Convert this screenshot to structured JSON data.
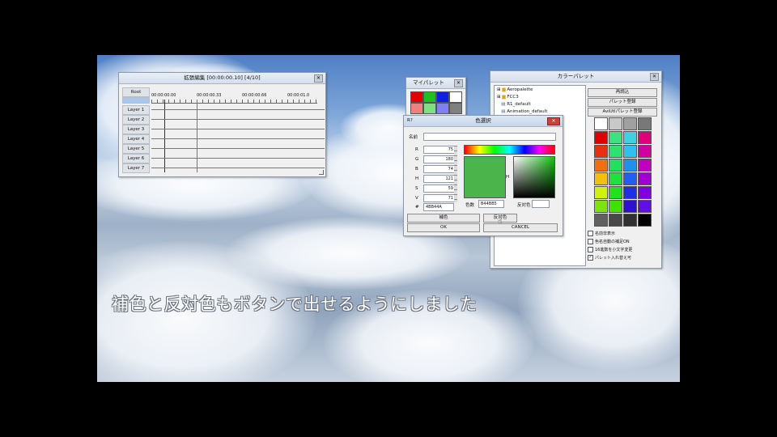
{
  "timeline": {
    "title": "拡張編集 [00:00:00.10] [4/10]",
    "root_label": "Root",
    "ruler": [
      "00:00:00.00",
      "00:00:00.33",
      "00:00:00.66",
      "00:00:01.0"
    ],
    "layers": [
      "Layer 1",
      "Layer 2",
      "Layer 3",
      "Layer 4",
      "Layer 5",
      "Layer 6",
      "Layer 7"
    ]
  },
  "my_palette": {
    "title": "マイパレット",
    "colors": [
      "#e00000",
      "#20c020",
      "#1020e0",
      "#ffffff",
      "#f08080",
      "#80e080",
      "#8080f0",
      "#808080"
    ]
  },
  "picker": {
    "title": "色選択",
    "corner_label": "R?",
    "name_label": "名前",
    "fields": [
      {
        "label": "R",
        "value": "75"
      },
      {
        "label": "G",
        "value": "180"
      },
      {
        "label": "B",
        "value": "74"
      },
      {
        "label": "H",
        "value": "121"
      },
      {
        "label": "S",
        "value": "59"
      },
      {
        "label": "V",
        "value": "71"
      }
    ],
    "hex_label": "#",
    "hex_value": "4BB44A",
    "selected_color": "#4bb44a",
    "comp_label": "補色",
    "comp_value": "B44BB5",
    "opp_label": "反対色",
    "swatch_note": "色数",
    "comp_button": "補色",
    "opp_button": "反対色",
    "ok_button": "OK",
    "cancel_button": "CANCEL",
    "right_letter": "H"
  },
  "color_palette": {
    "title": "カラーパレット",
    "tree": [
      "Aeropalette",
      "FCC3",
      "R1_default",
      "Animation_default"
    ],
    "buttons": [
      "再読込",
      "パレット登録",
      "AviUtlパレット登録"
    ],
    "grid_top": [
      "#ffffff",
      "#c8c8c8",
      "#a0a0a0",
      "#787878"
    ],
    "grid": [
      [
        "#e00000",
        "#40e080",
        "#40d0e0",
        "#e0007a"
      ],
      [
        "#e83010",
        "#30e070",
        "#30c0f0",
        "#d000a0"
      ],
      [
        "#f07010",
        "#20e060",
        "#2090f0",
        "#c000c0"
      ],
      [
        "#f0c010",
        "#20e040",
        "#2060f0",
        "#a000d0"
      ],
      [
        "#d0f010",
        "#20e020",
        "#2030e0",
        "#8000e0"
      ],
      [
        "#80e010",
        "#40e000",
        "#3010d0",
        "#6010e0"
      ],
      [
        "#606060",
        "#484848",
        "#303030",
        "#000000"
      ]
    ],
    "checks": [
      {
        "label": "名前非表示",
        "checked": false
      },
      {
        "label": "色名自動の補足ON",
        "checked": false
      },
      {
        "label": "16進数を小文字変更",
        "checked": false
      },
      {
        "label": "パレット入れ替え可",
        "checked": true
      }
    ]
  },
  "subtitle": "補色と反対色もボタンで出せるようにしました"
}
